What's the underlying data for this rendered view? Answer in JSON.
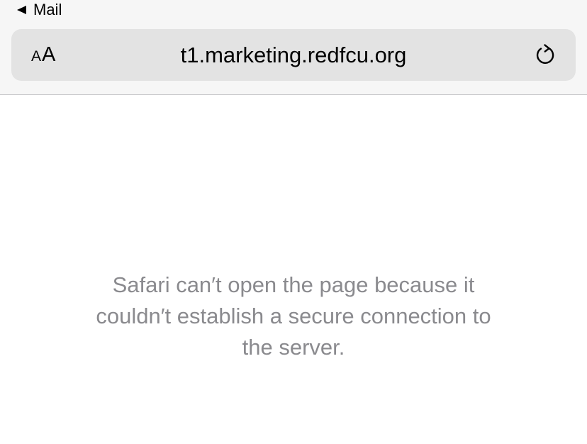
{
  "back_link": {
    "label": "Mail",
    "icon": "back-triangle-icon"
  },
  "address_bar": {
    "text_size_button": {
      "small": "A",
      "large": "A",
      "icon": "text-size-icon"
    },
    "url": "t1.marketing.redfcu.org",
    "reload_icon": "reload-icon"
  },
  "error": {
    "lines": [
      "Safari can′t open the page because it",
      "couldn′t establish a secure connection to",
      "the server."
    ]
  },
  "colors": {
    "toolbar_bg": "#f6f6f6",
    "address_bar_bg": "#e3e3e3",
    "error_text": "#8a8a8e"
  }
}
